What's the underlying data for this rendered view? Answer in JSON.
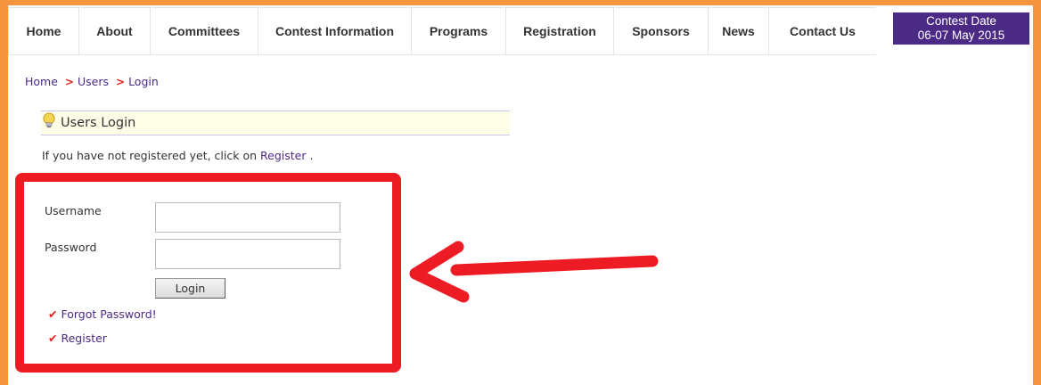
{
  "nav": {
    "items": [
      {
        "label": "Home"
      },
      {
        "label": "About"
      },
      {
        "label": "Committees"
      },
      {
        "label": "Contest Information"
      },
      {
        "label": "Programs"
      },
      {
        "label": "Registration"
      },
      {
        "label": "Sponsors"
      },
      {
        "label": "News"
      },
      {
        "label": "Contact Us"
      }
    ],
    "contest": {
      "line1": "Contest Date",
      "line2": "06-07 May 2015"
    }
  },
  "breadcrumb": {
    "items": [
      "Home",
      "Users",
      "Login"
    ],
    "separator": ">"
  },
  "login_panel": {
    "title": "Users Login",
    "icon": "lightbulb-icon"
  },
  "info": {
    "text_before": "If you have not registered yet, click on ",
    "link": "Register",
    "text_after": " ."
  },
  "form": {
    "username_label": "Username",
    "username_value": "",
    "password_label": "Password",
    "password_value": "",
    "login_label": "Login"
  },
  "links": {
    "check": "✔",
    "forgot": "Forgot Password!",
    "register": "Register"
  },
  "colors": {
    "frame": "#f7953f",
    "accent": "#4b2a86",
    "annotation": "#ed1c24"
  }
}
